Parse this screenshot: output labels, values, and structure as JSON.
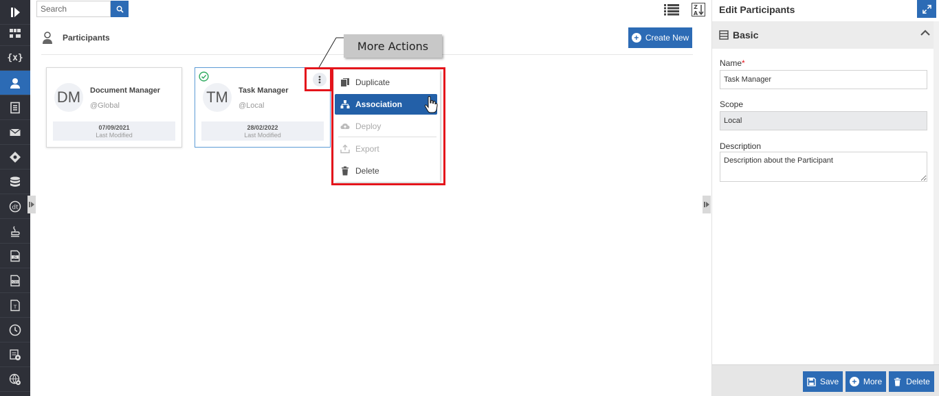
{
  "nav": {
    "items": [
      {
        "icon": "logo-icon"
      },
      {
        "icon": "process-flow-icon"
      },
      {
        "icon": "variables-icon"
      },
      {
        "icon": "participants-icon",
        "active": true
      },
      {
        "icon": "document-icon"
      },
      {
        "icon": "mail-icon"
      },
      {
        "icon": "decision-icon"
      },
      {
        "icon": "database-icon"
      },
      {
        "icon": "data-type-icon"
      },
      {
        "icon": "java-icon"
      },
      {
        "icon": "js-file-icon"
      },
      {
        "icon": "css-file-icon"
      },
      {
        "icon": "text-file-icon"
      },
      {
        "icon": "clock-icon"
      },
      {
        "icon": "report-settings-icon"
      },
      {
        "icon": "global-settings-icon"
      }
    ]
  },
  "toolbar": {
    "search_placeholder": "Search"
  },
  "main": {
    "section_title": "Participants",
    "create_label": "Create New",
    "cards": [
      {
        "initials": "DM",
        "name": "Document Manager",
        "scope": "@Global",
        "date": "07/09/2021",
        "modified_label": "Last Modified"
      },
      {
        "initials": "TM",
        "name": "Task Manager",
        "scope": "@Local",
        "date": "28/02/2022",
        "modified_label": "Last Modified"
      }
    ]
  },
  "callout": {
    "text": "More Actions"
  },
  "menu": {
    "items": [
      {
        "label": "Duplicate",
        "state": "normal"
      },
      {
        "label": "Association",
        "state": "active"
      },
      {
        "label": "Deploy",
        "state": "disabled"
      },
      {
        "label": "Export",
        "state": "disabled"
      },
      {
        "label": "Delete",
        "state": "normal"
      }
    ]
  },
  "panel": {
    "title": "Edit Participants",
    "section": "Basic",
    "name_label": "Name",
    "name_value": "Task Manager",
    "scope_label": "Scope",
    "scope_value": "Local",
    "description_label": "Description",
    "description_value": "Description about the Participant",
    "save_label": "Save",
    "more_label": "More",
    "delete_label": "Delete"
  },
  "colors": {
    "primary": "#2c6bb5",
    "rail": "#2e3038",
    "highlight": "#e4141b",
    "success": "#2eaa5f"
  }
}
